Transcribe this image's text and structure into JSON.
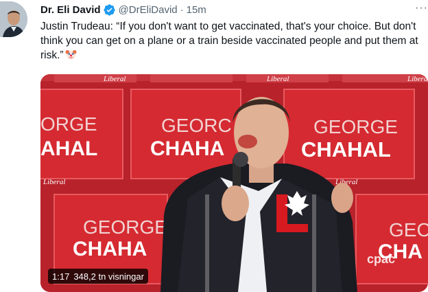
{
  "tweet": {
    "author_name": "Dr. Eli David",
    "handle": "@DrEliDavid",
    "separator": "·",
    "time": "15m",
    "more_label": "···",
    "text": "Justin Trudeau: “If you don't want to get vaccinated, that's your choice. But don't think you can get on a plane or a train beside vaccinated people and put them at risk.”",
    "verified": true
  },
  "media": {
    "type": "video",
    "duration": "1:17",
    "views": "348,2 tn visningar",
    "sign_text_line1": "GEORGE",
    "sign_text_line2": "CHAHAL",
    "sign_left_line1": "ORGE",
    "sign_left_line2": "AHAL",
    "sign_mid_line1": "GEORC",
    "sign_mid_line2": "CHAHA",
    "sign_bottom_left_line1": "GEORGE",
    "sign_bottom_left_line2": "CHAHA",
    "sign_bottom_right_line1": "GEC",
    "sign_bottom_right_line2": "CHA",
    "brand_small": "Liberal",
    "watermark": "cpac",
    "jacket_letter": "L"
  },
  "colors": {
    "verified_blue": "#1d9bf0",
    "liberal_red": "#d71920",
    "text_primary": "#0f1419",
    "text_secondary": "#536471"
  }
}
